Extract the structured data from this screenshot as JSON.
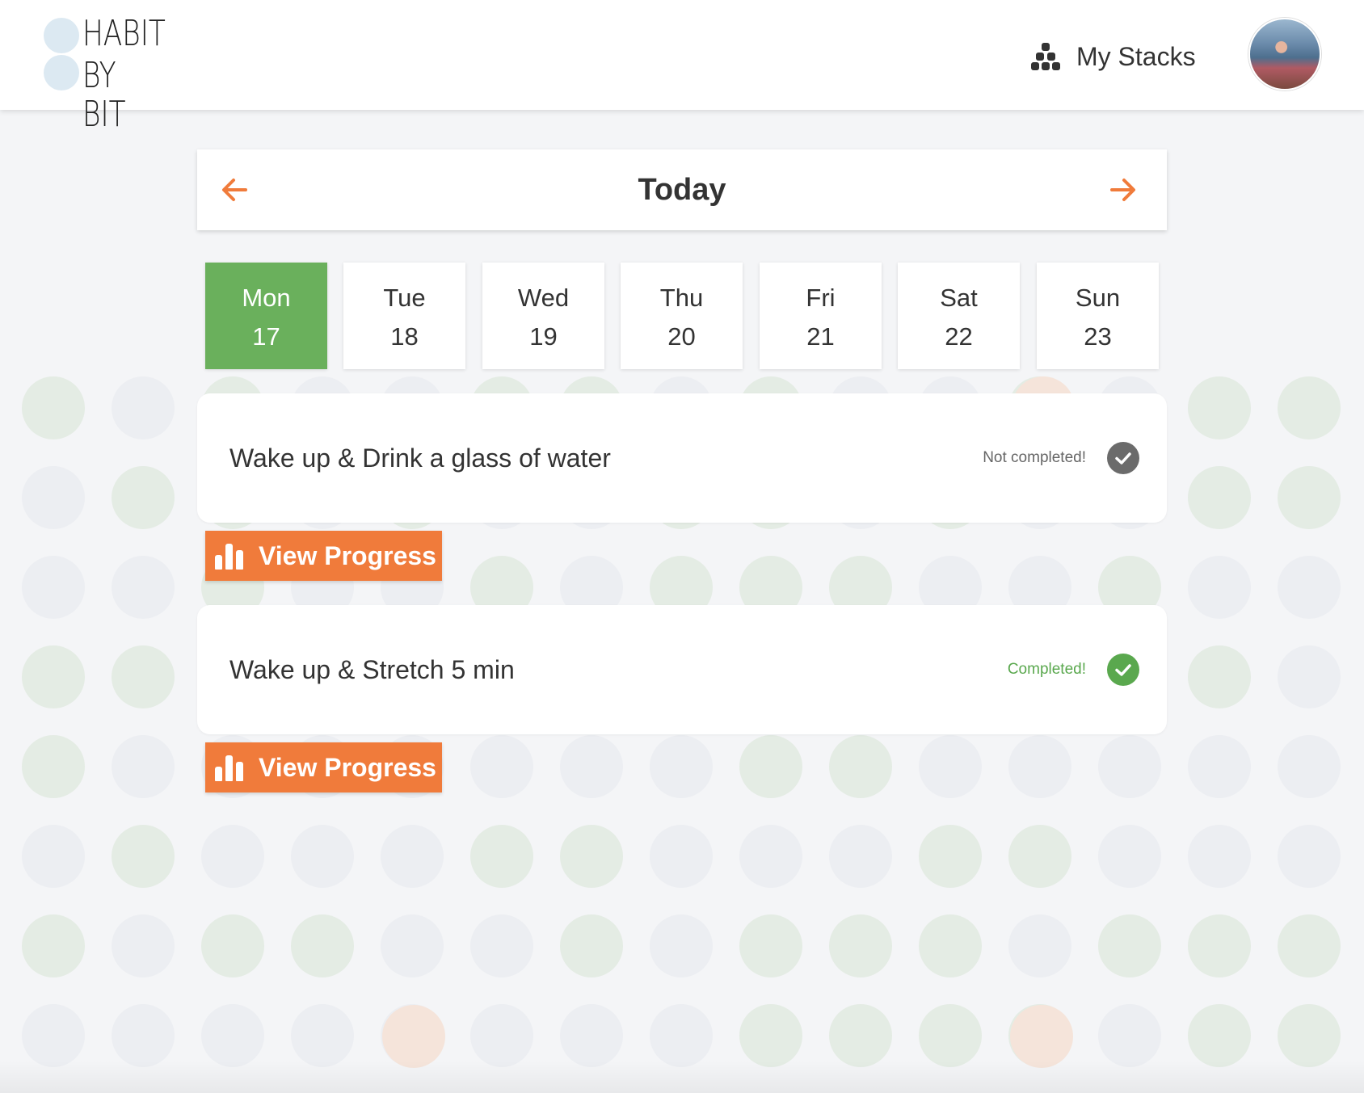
{
  "app": {
    "logo_line1": "HABIT",
    "logo_line2": "BY BIT"
  },
  "header": {
    "nav_label": "My Stacks",
    "nav_icon": "stacks-icon",
    "avatar": "user-avatar"
  },
  "date_nav": {
    "title": "Today",
    "prev_icon": "arrow-left-icon",
    "next_icon": "arrow-right-icon",
    "accent_color": "#f07b3b"
  },
  "week": {
    "selected_color": "#6ab05c",
    "days": [
      {
        "name": "Mon",
        "num": "17",
        "selected": true
      },
      {
        "name": "Tue",
        "num": "18",
        "selected": false
      },
      {
        "name": "Wed",
        "num": "19",
        "selected": false
      },
      {
        "name": "Thu",
        "num": "20",
        "selected": false
      },
      {
        "name": "Fri",
        "num": "21",
        "selected": false
      },
      {
        "name": "Sat",
        "num": "22",
        "selected": false
      },
      {
        "name": "Sun",
        "num": "23",
        "selected": false
      }
    ]
  },
  "habits": [
    {
      "name": "Wake up & Drink a glass of water",
      "status": "Not completed!",
      "completed": false,
      "button": "View Progress"
    },
    {
      "name": "Wake up & Stretch 5 min",
      "status": "Completed!",
      "completed": true,
      "button": "View Progress"
    }
  ],
  "colors": {
    "button": "#f07b3b",
    "completed": "#5aa84e",
    "not_completed": "#6b6b6b"
  }
}
